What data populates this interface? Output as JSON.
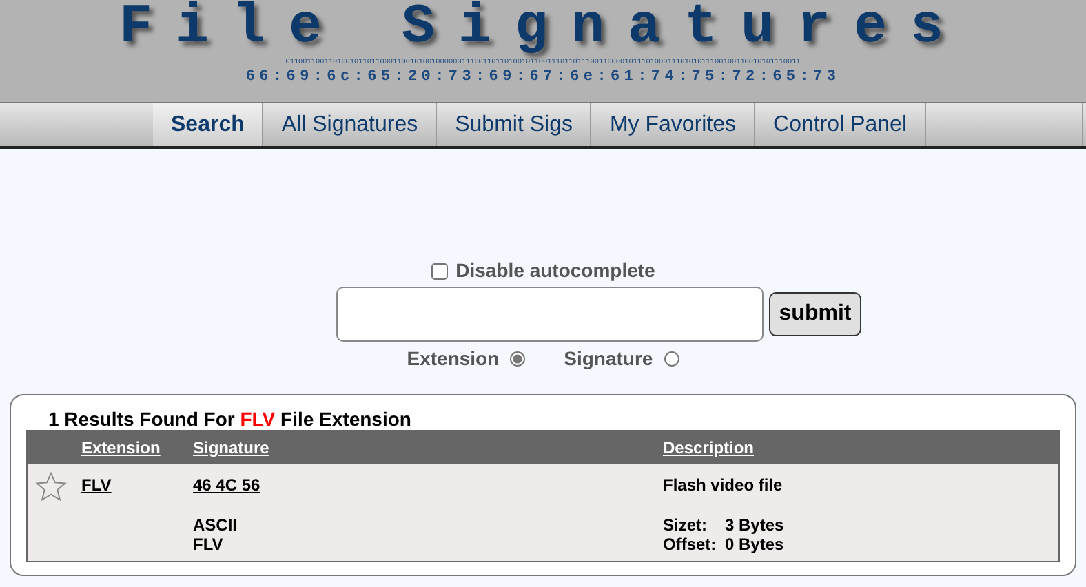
{
  "header": {
    "title": "File Signatures",
    "binary": "011001100110100101101100011001010010000001110011011010010110011101101110011000010111010001110101011100100110010101110011",
    "hex": "66:69:6c:65:20:73:69:67:6e:61:74:75:72:65:73"
  },
  "tabs": [
    {
      "label": "Search",
      "selected": true
    },
    {
      "label": "All Signatures",
      "selected": false
    },
    {
      "label": "Submit Sigs",
      "selected": false
    },
    {
      "label": "My Favorites",
      "selected": false
    },
    {
      "label": "Control Panel",
      "selected": false
    }
  ],
  "search": {
    "autocomplete_label": "Disable autocomplete",
    "autocomplete_checked": false,
    "submit": "submit",
    "modes": [
      {
        "label": "Extension",
        "selected": true
      },
      {
        "label": "Signature",
        "selected": false
      }
    ]
  },
  "results": {
    "heading": "1 Results Found For **FLV** File Extension",
    "columns": [
      "Extension",
      "Signature",
      "Description"
    ],
    "rows": [
      {
        "favorite": false,
        "extension": "FLV",
        "signature": "46 4C 56",
        "ascii_label": "ASCII",
        "ascii": "FLV",
        "description": "Flash video file",
        "size_label": "Sizet:",
        "size": "3 Bytes",
        "offset_label": "Offset:",
        "offset": "0 Bytes"
      }
    ]
  }
}
